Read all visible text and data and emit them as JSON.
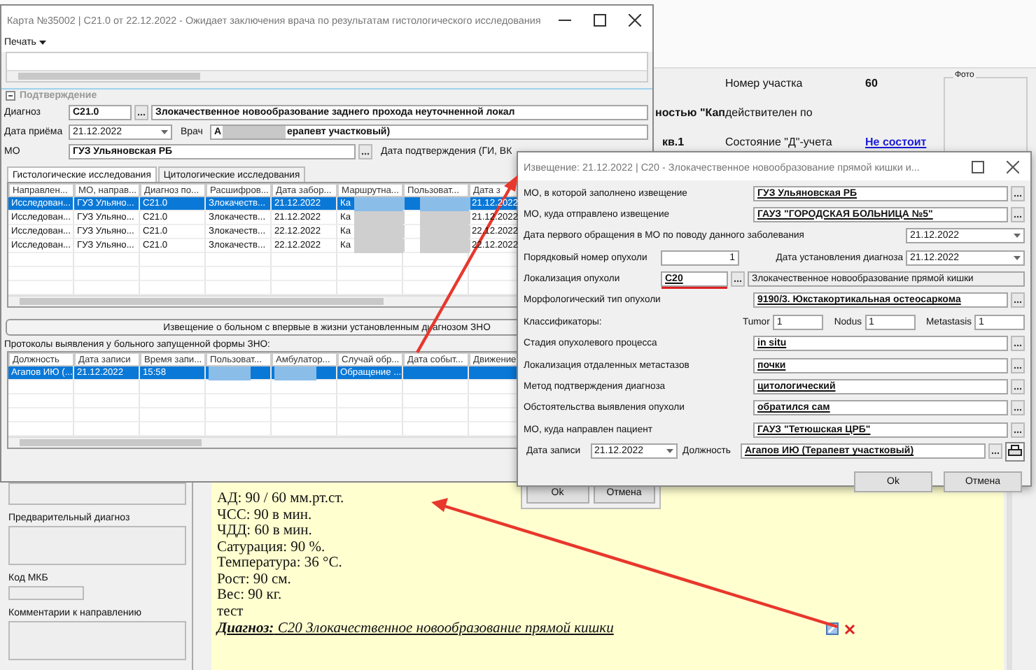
{
  "background": {
    "district_label": "Номер участка",
    "district_value": "60",
    "name_fragment": "ностью \"Кап",
    "valid_label": "действителен по",
    "address_fragment": "кв.1",
    "d_status_label": "Состояние \"Д\"-учета",
    "d_status_link": "Не состоит",
    "photo_label": "Фото",
    "left_labels": [
      "Предварительный диагноз",
      "Код МКБ",
      "Комментарии к направлению"
    ],
    "document_lines": [
      "АД: 90 / 60 мм.рт.ст.",
      "ЧСС: 90 в мин.",
      "ЧДД: 60 в мин.",
      "Сатурация: 90 %.",
      "Температура: 36 °С.",
      "Рост: 90 см.",
      "Вес: 90 кг.",
      "тест"
    ],
    "document_diagnosis": "**Диагноз:** C20 Злокачественное новообразование прямой кишки",
    "hidden_dialog_buttons": [
      "Ok",
      "Отмена"
    ]
  },
  "card_window": {
    "title": "Карта №35002 | C21.0 от 22.12.2022 - Ожидает заключения врача по результатам гистологического исследования",
    "menu": "Печать",
    "section": "Подтверждение",
    "diagnosis_label": "Диагноз",
    "diagnosis_code": "C21.0",
    "diagnosis_text": "Злокачественное новообразование заднего прохода неуточненной локал",
    "date_label": "Дата приёма",
    "date_value": "21.12.2022",
    "doctor_label": "Врач",
    "doctor_prefix": "А",
    "doctor_suffix": "ерапевт участковый)",
    "mo_label": "МО",
    "mo_value": "ГУЗ Ульяновская РБ",
    "confirm_label": "Дата подтверждения (ГИ, ВК",
    "tabs": [
      {
        "label": "Гистологические исследования",
        "selected": true
      },
      {
        "label": "Цитологические исследования",
        "selected": false
      }
    ],
    "columns": [
      "Направлен...",
      "МО, направ...",
      "Диагноз по...",
      "Расшифров...",
      "Дата забор...",
      "Маршрутна...",
      "Пользоват...",
      "Дата з"
    ],
    "rows": [
      {
        "selected": true,
        "cells": [
          "Исследован...",
          "ГУЗ Ульяно...",
          "C21.0",
          "Злокачеств...",
          "21.12.2022",
          {
            "redacted": true,
            "text": "Ка"
          },
          {
            "redacted": true
          },
          "21.12.2022"
        ]
      },
      {
        "selected": false,
        "cells": [
          "Исследован...",
          "ГУЗ Ульяно...",
          "C21.0",
          "Злокачеств...",
          "21.12.2022",
          {
            "redacted": true,
            "text": "Ка"
          },
          {
            "redacted": true
          },
          "21.12.2022"
        ]
      },
      {
        "selected": false,
        "cells": [
          "Исследован...",
          "ГУЗ Ульяно...",
          "C21.0",
          "Злокачеств...",
          "22.12.2022",
          {
            "redacted": true,
            "text": "Ка"
          },
          {
            "redacted": true
          },
          "22.12.2022"
        ]
      },
      {
        "selected": false,
        "cells": [
          "Исследован...",
          "ГУЗ Ульяно...",
          "C21.0",
          "Злокачеств...",
          "22.12.2022",
          {
            "redacted": true,
            "text": "Ка"
          },
          {
            "redacted": true
          },
          "22.12.2022"
        ]
      }
    ],
    "notice_button": "Извещение о больном с впервые в жизни установленным диагнозом ЗНО",
    "protocols_label": "Протоколы выявления у больного запущенной формы ЗНО:",
    "protocol_columns": [
      "Должность",
      "Дата записи",
      "Время запи...",
      "Пользоват...",
      "Амбулатор...",
      "Случай обр...",
      "Дата событ...",
      "Движение"
    ],
    "protocol_rows": [
      {
        "selected": true,
        "cells": [
          "Агапов ИЮ (...",
          "21.12.2022",
          "15:58",
          {
            "redacted": true
          },
          {
            "redacted": true
          },
          "Обращение ..."
        ]
      }
    ]
  },
  "notice_dialog": {
    "title": "Извещение: 21.12.2022 | C20 - Злокачественное новообразование прямой кишки и...",
    "rows": [
      {
        "kind": "lookup",
        "label": "МО, в которой заполнено извещение",
        "value": "ГУЗ Ульяновская РБ"
      },
      {
        "kind": "lookup",
        "label": "МО, куда отправлено извещение",
        "value": "ГАУЗ \"ГОРОДСКАЯ БОЛЬНИЦА №5\""
      },
      {
        "kind": "date",
        "label": "Дата первого обращения в МО по поводу данного заболевания",
        "value": "21.12.2022"
      },
      {
        "kind": "pair",
        "label": "Порядковый номер опухоли",
        "value": "1",
        "label2": "Дата установления диагноза",
        "value2": "21.12.2022"
      },
      {
        "kind": "code",
        "label": "Локализация опухоли",
        "value": "C20",
        "value2": "Злокачественное новообразование прямой кишки",
        "highlighted": true
      },
      {
        "kind": "lookup",
        "label": "Морфологический тип опухоли",
        "value": "9190/3. Юкстакортикальная остеосаркома"
      },
      {
        "kind": "classifiers",
        "label": "Классификаторы:",
        "items": [
          {
            "label": "Tumor",
            "value": "1"
          },
          {
            "label": "Nodus",
            "value": "1"
          },
          {
            "label": "Metastasis",
            "value": "1"
          }
        ]
      },
      {
        "kind": "lookup",
        "label": "Стадия опухолевого процесса",
        "value": "in situ"
      },
      {
        "kind": "lookup",
        "label": "Локализация отдаленных метастазов",
        "value": "почки"
      },
      {
        "kind": "lookup",
        "label": "Метод подтверждения диагноза",
        "value": "цитологический"
      },
      {
        "kind": "lookup",
        "label": "Обстоятельства выявления опухоли",
        "value": "обратился сам"
      },
      {
        "kind": "lookup",
        "label": "МО, куда направлен пациент",
        "value": " ГАУЗ \"Тетюшская ЦРБ\""
      },
      {
        "kind": "record",
        "label": "Дата записи",
        "value": "21.12.2022",
        "label2": "Должность",
        "value2": "Агапов ИЮ (Терапевт участковый)"
      }
    ],
    "buttons": [
      "Ok",
      "Отмена"
    ]
  }
}
